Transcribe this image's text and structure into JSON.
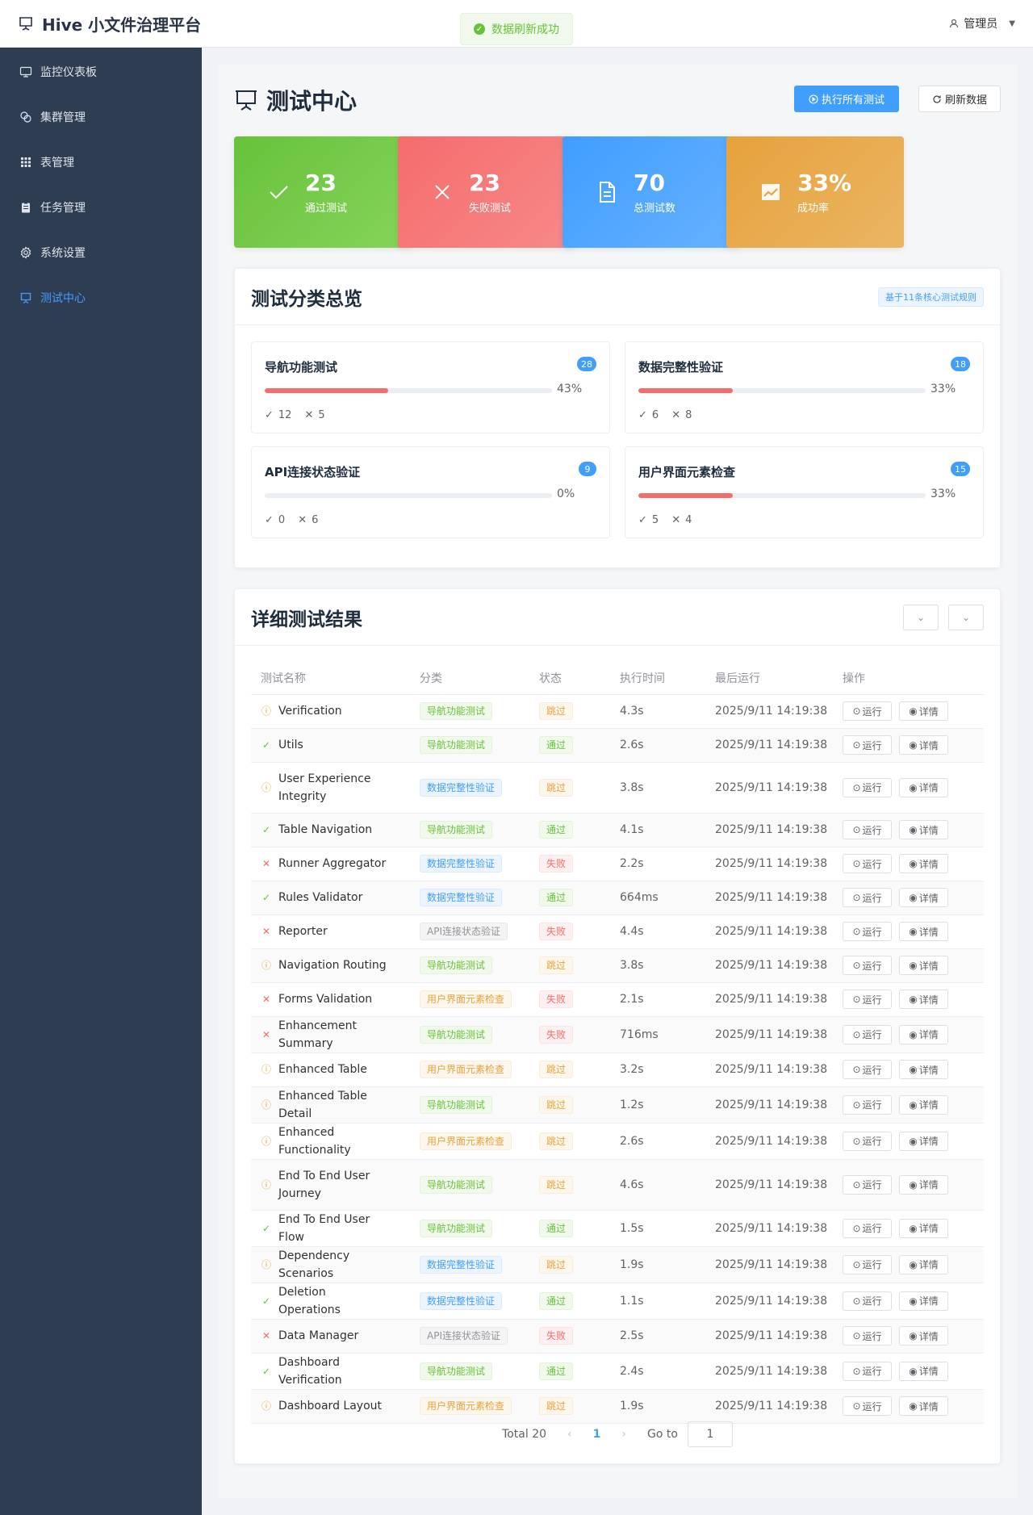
{
  "app": {
    "title": "Hive 小文件治理平台",
    "user": "管理员"
  },
  "toast": {
    "text": "数据刷新成功"
  },
  "sidebar": {
    "items": [
      {
        "label": "监控仪表板",
        "icon": "monitor-icon"
      },
      {
        "label": "集群管理",
        "icon": "cluster-icon"
      },
      {
        "label": "表管理",
        "icon": "grid-icon"
      },
      {
        "label": "任务管理",
        "icon": "clipboard-icon"
      },
      {
        "label": "系统设置",
        "icon": "gear-icon"
      },
      {
        "label": "测试中心",
        "icon": "presentation-icon",
        "active": true
      }
    ]
  },
  "page": {
    "title": "测试中心",
    "run_all": "执行所有测试",
    "refresh": "刷新数据"
  },
  "stats": [
    {
      "value": "23",
      "label": "通过测试",
      "icon": "check-icon",
      "color": "#67c23a"
    },
    {
      "value": "23",
      "label": "失败测试",
      "icon": "close-icon",
      "color": "#f56c6c"
    },
    {
      "value": "70",
      "label": "总测试数",
      "icon": "document-icon",
      "color": "#409eff"
    },
    {
      "value": "33%",
      "label": "成功率",
      "icon": "trend-icon",
      "color": "#e6a23c"
    }
  ],
  "categories": {
    "title": "测试分类总览",
    "tag": "基于11条核心测试规则",
    "items": [
      {
        "name": "导航功能测试",
        "count": "28",
        "percent": 43,
        "percent_label": "43%",
        "passed": "12",
        "failed": "5"
      },
      {
        "name": "数据完整性验证",
        "count": "18",
        "percent": 33,
        "percent_label": "33%",
        "passed": "6",
        "failed": "8"
      },
      {
        "name": "API连接状态验证",
        "count": "9",
        "percent": 0,
        "percent_label": "0%",
        "passed": "0",
        "failed": "6"
      },
      {
        "name": "用户界面元素检查",
        "count": "15",
        "percent": 33,
        "percent_label": "33%",
        "passed": "5",
        "failed": "4"
      }
    ]
  },
  "results": {
    "title": "详细测试结果",
    "columns": [
      "测试名称",
      "分类",
      "状态",
      "执行时间",
      "最后运行",
      "操作"
    ],
    "run_label": "运行",
    "detail_label": "详情",
    "rows": [
      {
        "name": "Verification",
        "category": "导航功能测试",
        "cat_color": "green",
        "status": "跳过",
        "status_type": "skip",
        "time": "4.3s",
        "last_run": "2025/9/11 14:19:38"
      },
      {
        "name": "Utils",
        "category": "导航功能测试",
        "cat_color": "green",
        "status": "通过",
        "status_type": "pass",
        "time": "2.6s",
        "last_run": "2025/9/11 14:19:38"
      },
      {
        "name": "User Experience Integrity",
        "category": "数据完整性验证",
        "cat_color": "blue",
        "status": "跳过",
        "status_type": "skip",
        "time": "3.8s",
        "last_run": "2025/9/11 14:19:38",
        "tall": true
      },
      {
        "name": "Table Navigation",
        "category": "导航功能测试",
        "cat_color": "green",
        "status": "通过",
        "status_type": "pass",
        "time": "4.1s",
        "last_run": "2025/9/11 14:19:38"
      },
      {
        "name": "Runner Aggregator",
        "category": "数据完整性验证",
        "cat_color": "blue",
        "status": "失败",
        "status_type": "fail",
        "time": "2.2s",
        "last_run": "2025/9/11 14:19:38"
      },
      {
        "name": "Rules Validator",
        "category": "数据完整性验证",
        "cat_color": "blue",
        "status": "通过",
        "status_type": "pass",
        "time": "664ms",
        "last_run": "2025/9/11 14:19:38"
      },
      {
        "name": "Reporter",
        "category": "API连接状态验证",
        "cat_color": "gray",
        "status": "失败",
        "status_type": "fail",
        "time": "4.4s",
        "last_run": "2025/9/11 14:19:38"
      },
      {
        "name": "Navigation Routing",
        "category": "导航功能测试",
        "cat_color": "green",
        "status": "跳过",
        "status_type": "skip",
        "time": "3.8s",
        "last_run": "2025/9/11 14:19:38"
      },
      {
        "name": "Forms Validation",
        "category": "用户界面元素检查",
        "cat_color": "orange",
        "status": "失败",
        "status_type": "fail",
        "time": "2.1s",
        "last_run": "2025/9/11 14:19:38"
      },
      {
        "name": "Enhancement Summary",
        "category": "导航功能测试",
        "cat_color": "green",
        "status": "失败",
        "status_type": "fail",
        "time": "716ms",
        "last_run": "2025/9/11 14:19:38"
      },
      {
        "name": "Enhanced Table",
        "category": "用户界面元素检查",
        "cat_color": "orange",
        "status": "跳过",
        "status_type": "skip",
        "time": "3.2s",
        "last_run": "2025/9/11 14:19:38"
      },
      {
        "name": "Enhanced Table Detail",
        "category": "导航功能测试",
        "cat_color": "green",
        "status": "跳过",
        "status_type": "skip",
        "time": "1.2s",
        "last_run": "2025/9/11 14:19:38"
      },
      {
        "name": "Enhanced Functionality",
        "category": "用户界面元素检查",
        "cat_color": "orange",
        "status": "跳过",
        "status_type": "skip",
        "time": "2.6s",
        "last_run": "2025/9/11 14:19:38"
      },
      {
        "name": "End To End User Journey",
        "category": "导航功能测试",
        "cat_color": "green",
        "status": "跳过",
        "status_type": "skip",
        "time": "4.6s",
        "last_run": "2025/9/11 14:19:38",
        "tall": true
      },
      {
        "name": "End To End User Flow",
        "category": "导航功能测试",
        "cat_color": "green",
        "status": "通过",
        "status_type": "pass",
        "time": "1.5s",
        "last_run": "2025/9/11 14:19:38"
      },
      {
        "name": "Dependency Scenarios",
        "category": "数据完整性验证",
        "cat_color": "blue",
        "status": "跳过",
        "status_type": "skip",
        "time": "1.9s",
        "last_run": "2025/9/11 14:19:38"
      },
      {
        "name": "Deletion Operations",
        "category": "数据完整性验证",
        "cat_color": "blue",
        "status": "通过",
        "status_type": "pass",
        "time": "1.1s",
        "last_run": "2025/9/11 14:19:38"
      },
      {
        "name": "Data Manager",
        "category": "API连接状态验证",
        "cat_color": "gray",
        "status": "失败",
        "status_type": "fail",
        "time": "2.5s",
        "last_run": "2025/9/11 14:19:38"
      },
      {
        "name": "Dashboard Verification",
        "category": "导航功能测试",
        "cat_color": "green",
        "status": "通过",
        "status_type": "pass",
        "time": "2.4s",
        "last_run": "2025/9/11 14:19:38"
      },
      {
        "name": "Dashboard Layout",
        "category": "用户界面元素检查",
        "cat_color": "orange",
        "status": "跳过",
        "status_type": "skip",
        "time": "1.9s",
        "last_run": "2025/9/11 14:19:38"
      }
    ]
  },
  "pagination": {
    "total": "Total 20",
    "current": "1",
    "goto_label": "Go to",
    "goto_value": "1"
  }
}
